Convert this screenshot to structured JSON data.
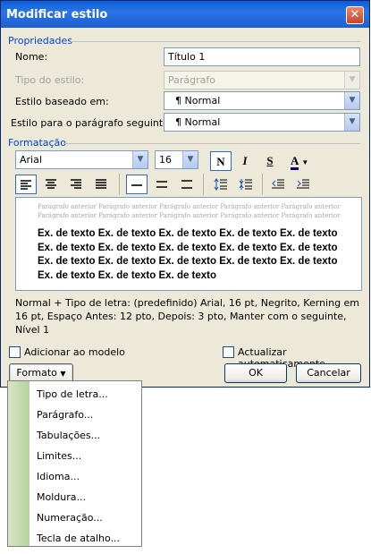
{
  "window": {
    "title": "Modificar estilo",
    "close_symbol": "✕"
  },
  "properties": {
    "group_title": "Propriedades",
    "name_label": "Nome:",
    "name_value": "Título 1",
    "type_label": "Tipo do estilo:",
    "type_value": "Parágrafo",
    "based_label": "Estilo baseado em:",
    "based_value": "¶ Normal",
    "next_label": "Estilo para o parágrafo seguinte:",
    "next_value": "¶ Normal"
  },
  "formatting": {
    "group_title": "Formatação",
    "font": "Arial",
    "size": "16",
    "bold": "N",
    "italic": "I",
    "underline": "S",
    "font_color": "A",
    "preview_previous": "Parágrafo anterior Parágrafo anterior Parágrafo anterior Parágrafo anterior Parágrafo anterior Parágrafo anterior Parágrafo anterior Parágrafo anterior Parágrafo anterior Parágrafo anterior",
    "preview_sample": "Ex. de texto Ex. de texto Ex. de texto Ex. de texto Ex. de texto Ex. de texto Ex. de texto Ex. de texto Ex. de texto Ex. de texto Ex. de texto Ex. de texto Ex. de texto Ex. de texto Ex. de texto Ex. de texto Ex. de texto Ex. de texto",
    "description": "Normal + Tipo de letra: (predefinido) Arial, 16 pt, Negrito, Kerning em 16 pt, Espaço Antes:  12 pto, Depois:  3 pto, Manter com o seguinte, Nível 1"
  },
  "options": {
    "add_to_template": "Adicionar ao modelo",
    "auto_update": "Actualizar automaticamente"
  },
  "buttons": {
    "format": "Formato",
    "ok": "OK",
    "cancel": "Cancelar"
  },
  "format_menu": [
    "Tipo de letra...",
    "Parágrafo...",
    "Tabulações...",
    "Limites...",
    "Idioma...",
    "Moldura...",
    "Numeração...",
    "Tecla de atalho..."
  ],
  "colors": {
    "accent_title": "#0046d5",
    "titlebar": "#0a5fd8",
    "font_color_bar": "#000080"
  }
}
